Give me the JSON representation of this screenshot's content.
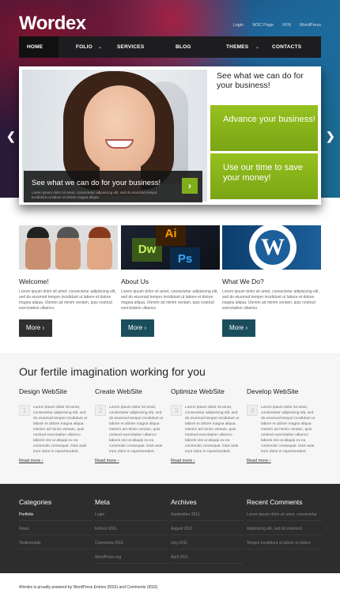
{
  "header": {
    "logo": "Wordex",
    "top_links": [
      "Login",
      "W3C Page",
      "XFN",
      "WordPress"
    ]
  },
  "nav": {
    "items": [
      {
        "label": "HOME",
        "has_dropdown": false
      },
      {
        "label": "FOLIO",
        "has_dropdown": true
      },
      {
        "label": "SERVICES",
        "has_dropdown": false
      },
      {
        "label": "BLOG",
        "has_dropdown": false
      },
      {
        "label": "THEMES",
        "has_dropdown": true
      },
      {
        "label": "CONTACTS",
        "has_dropdown": false
      }
    ]
  },
  "slider": {
    "caption_title": "See what we can do for your business!",
    "caption_text": "Lorem ipsum dolor sit amet, consectetur adipisicing elit, sed do eiusmod tempor incididunt ut labore et dolore magna aliqua.",
    "right_heading": "See what we can do for your business!",
    "box1": "Advance your business!",
    "box2": "Use our time to save your money!",
    "prev_icon": "arrow-left-icon",
    "next_icon": "arrow-right-icon"
  },
  "features": [
    {
      "title": "Welcome!",
      "text": "Lorem ipsum dolor sit amet, consectetur adipisicing elit, sed do eiusmod tempor incididunt ut labore et dolore magna aliqua. Utenim ad minim veniam, quis nostrud exercitation ullamco.",
      "button": "More"
    },
    {
      "title": "About Us",
      "text": "Lorem ipsum dolor sit amet, consectetur adipisicing elit, sed do eiusmod tempor incididunt ut labore et dolore magna aliqua. Utenim ad minim veniam, quis nostrud exercitation ullamco.",
      "button": "More"
    },
    {
      "title": "What We Do?",
      "text": "Lorem ipsum dolor sit amet, consectetur adipisicing elit, sed do eiusmod tempor incididunt ut labore et dolore magna aliqua. Utenim ad minim veniam, quis nostrud exercitation ullamco.",
      "button": "More"
    }
  ],
  "feature_images": {
    "adobe_labels": [
      "Dw",
      "Ai",
      "Ps"
    ],
    "wp_letter": "W"
  },
  "services": {
    "heading": "Our fertile imagination working for you",
    "items": [
      {
        "title": "Design WebSite",
        "num": "1",
        "text": "Lorem ipsum dolor sit amet, consectetur adipisicing elit, sed do eiusmod tempor incididunt ut labore et dolore magna aliqua. Utenim ad minim veniam, quis nostrud exercitation ullamco laboris nisi ut aliquip ex ea commodo consequat. Duis aute irure dolor in reprehenderit.",
        "link": "Read more"
      },
      {
        "title": "Create WebSite",
        "num": "2",
        "text": "Lorem ipsum dolor sit amet, consectetur adipisicing elit, sed do eiusmod tempor incididunt ut labore et dolore magna aliqua. Utenim ad minim veniam, quis nostrud exercitation ullamco laboris nisi ut aliquip ex ea commodo consequat. Duis aute irure dolor in reprehenderit.",
        "link": "Read more"
      },
      {
        "title": "Optimize WebSite",
        "num": "3",
        "text": "Lorem ipsum dolor sit amet, consectetur adipisicing elit, sed do eiusmod tempor incididunt ut labore et dolore magna aliqua. Utenim ad minim veniam, quis nostrud exercitation ullamco laboris nisi ut aliquip ex ea commodo consequat. Duis aute irure dolor in reprehenderit.",
        "link": "Read more"
      },
      {
        "title": "Develop WebSite",
        "num": "4",
        "text": "Lorem ipsum dolor sit amet, consectetur adipisicing elit, sed do eiusmod tempor incididunt ut labore et dolore magna aliqua. Utenim ad minim veniam, quis nostrud exercitation ullamco laboris nisi ut aliquip ex ea commodo consequat. Duis aute irure dolor in reprehenderit.",
        "link": "Read more"
      }
    ]
  },
  "footer": {
    "columns": [
      {
        "title": "Categories",
        "items": [
          "Portfolio",
          "News",
          "Testimonials"
        ]
      },
      {
        "title": "Meta",
        "items": [
          "Login",
          "Entries RSS",
          "Comments RSS",
          "WordPress.org"
        ]
      },
      {
        "title": "Archives",
        "items": [
          "September 2011",
          "August 2011",
          "July 2011",
          "April 2011"
        ]
      },
      {
        "title": "Recent Comments",
        "items": [
          "Lorem ipsum dolor sit amet, consectetur",
          "Adipisicing elit, sed do eiusmod",
          "Tempor incididunt ut labore et dolore"
        ]
      }
    ],
    "copyright": "Wordex is proudly powered by WordPress  Entries (RSS) and Comments (RSS)"
  },
  "colors": {
    "accent_green": "#8ab81b",
    "button_dark": "#303030",
    "button_teal": "#1b4e5c",
    "footer_bg": "#2d2d2d"
  }
}
